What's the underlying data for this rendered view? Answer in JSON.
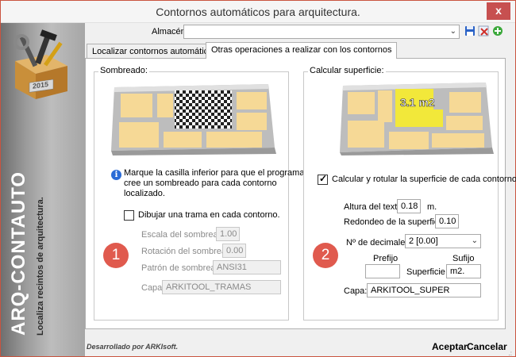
{
  "window": {
    "title": "Contornos automáticos para arquitectura.",
    "close_glyph": "x"
  },
  "sidebar": {
    "year_badge": "2015",
    "vertical_title": "ARQ-CONTAUTO",
    "vertical_subtitle": "Localiza recintos de arquitectura."
  },
  "header": {
    "almacen_label": "Almacén",
    "almacen_value": ""
  },
  "tabs": [
    {
      "label": "Localizar contornos automáticamente",
      "active": false
    },
    {
      "label": "Otras operaciones a realizar con los contornos",
      "active": true
    }
  ],
  "shading": {
    "group_title": "Sombreado:",
    "info_text_1": "Marque la casilla inferior para que el programa",
    "info_text_2": "cree un sombreado para cada contorno",
    "info_text_3": "localizado.",
    "checkbox_label": "Dibujar una trama en cada contorno.",
    "checked": false,
    "scale_label": "Escala del sombreado:",
    "scale_value": "1.00",
    "rotation_label": "Rotación del sombreado:",
    "rotation_value": "0.00",
    "pattern_label": "Patrón de sombreado:",
    "pattern_value": "ANSI31",
    "layer_label": "Capa:",
    "layer_value": "ARKITOOL_TRAMAS",
    "badge": "1"
  },
  "surface": {
    "group_title": "Calcular superficie:",
    "room_label": "3.1 m2",
    "checkbox_label": "Calcular y rotular la superficie de cada contorno.",
    "checked": true,
    "text_height_label": "Altura del texto:",
    "text_height_value": "0.18",
    "text_height_unit": "m.",
    "rounding_label": "Redondeo de la superficie:",
    "rounding_value": "0.10",
    "decimals_label": "Nº de decimales:",
    "decimals_value": "2 [0.00]",
    "prefix_label": "Prefijo",
    "prefix_value": "",
    "superficie_label": "Superficie",
    "suffix_label": "Sufijo",
    "suffix_value": "m2.",
    "layer_label": "Capa:",
    "layer_value": "ARKITOOL_SUPER",
    "badge": "2"
  },
  "footer": {
    "developer": "Desarrollado por ARKIsoft.",
    "accept": "Aceptar",
    "cancel": "Cancelar",
    "grip": ".:"
  },
  "colors": {
    "accent_badge": "#e05a4e",
    "room_highlight": "#f2e83a",
    "room_fill": "#f6d996",
    "window_border": "#c9543f",
    "close_button": "#c75050"
  }
}
